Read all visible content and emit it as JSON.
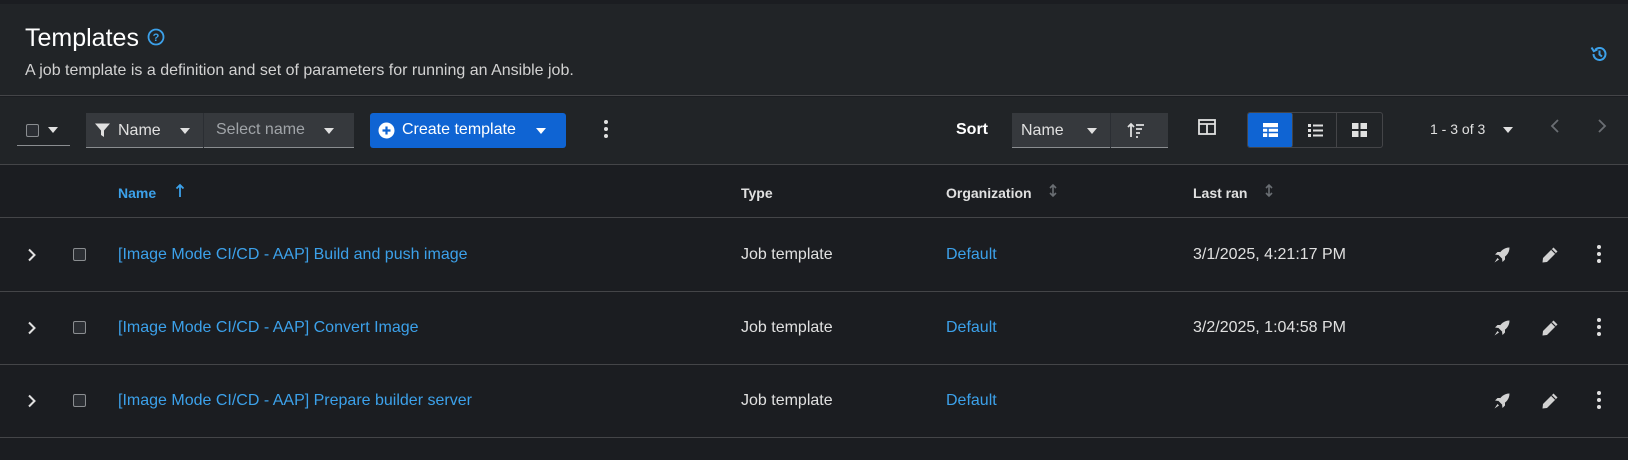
{
  "header": {
    "title": "Templates",
    "description": "A job template is a definition and set of parameters for running an Ansible job."
  },
  "toolbar": {
    "filter_attribute": "Name",
    "filter_placeholder": "Select name",
    "create_label": "Create template",
    "sort_label": "Sort",
    "sort_attribute": "Name",
    "pagination": "1 - 3 of 3"
  },
  "table": {
    "columns": {
      "name": "Name",
      "type": "Type",
      "organization": "Organization",
      "last_ran": "Last ran"
    },
    "rows": [
      {
        "name": "[Image Mode CI/CD - AAP] Build and push image",
        "type": "Job template",
        "organization": "Default",
        "last_ran": "3/1/2025, 4:21:17 PM"
      },
      {
        "name": "[Image Mode CI/CD - AAP] Convert Image",
        "type": "Job template",
        "organization": "Default",
        "last_ran": "3/2/2025, 1:04:58 PM"
      },
      {
        "name": "[Image Mode CI/CD - AAP] Prepare builder server",
        "type": "Job template",
        "organization": "Default",
        "last_ran": ""
      }
    ]
  },
  "colors": {
    "background": "#1b1d21",
    "panel": "#212427",
    "accent": "#0f64d3",
    "link": "#3ca1ea"
  },
  "icons": [
    "help-icon",
    "history-icon",
    "filter-icon",
    "plus-circle-icon",
    "kebab-icon",
    "sort-direction-icon",
    "columns-icon",
    "table-view-icon",
    "list-view-icon",
    "card-view-icon",
    "chevron-left-icon",
    "chevron-right-icon",
    "chevron-right-expand-icon",
    "rocket-launch-icon",
    "pencil-edit-icon"
  ]
}
